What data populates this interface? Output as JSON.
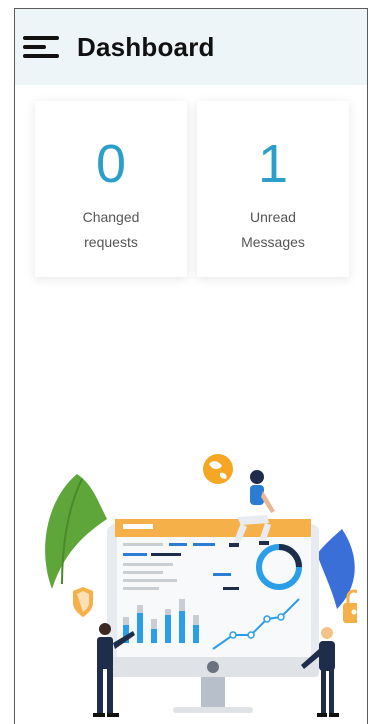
{
  "header": {
    "title": "Dashboard"
  },
  "cards": [
    {
      "value": "0",
      "label": "Changed\nrequests"
    },
    {
      "value": "1",
      "label": "Unread\nMessages"
    }
  ],
  "colors": {
    "accent": "#2b9ec9",
    "header_bg": "#eef5f8"
  },
  "icons": {
    "menu": "hamburger-menu-icon"
  }
}
